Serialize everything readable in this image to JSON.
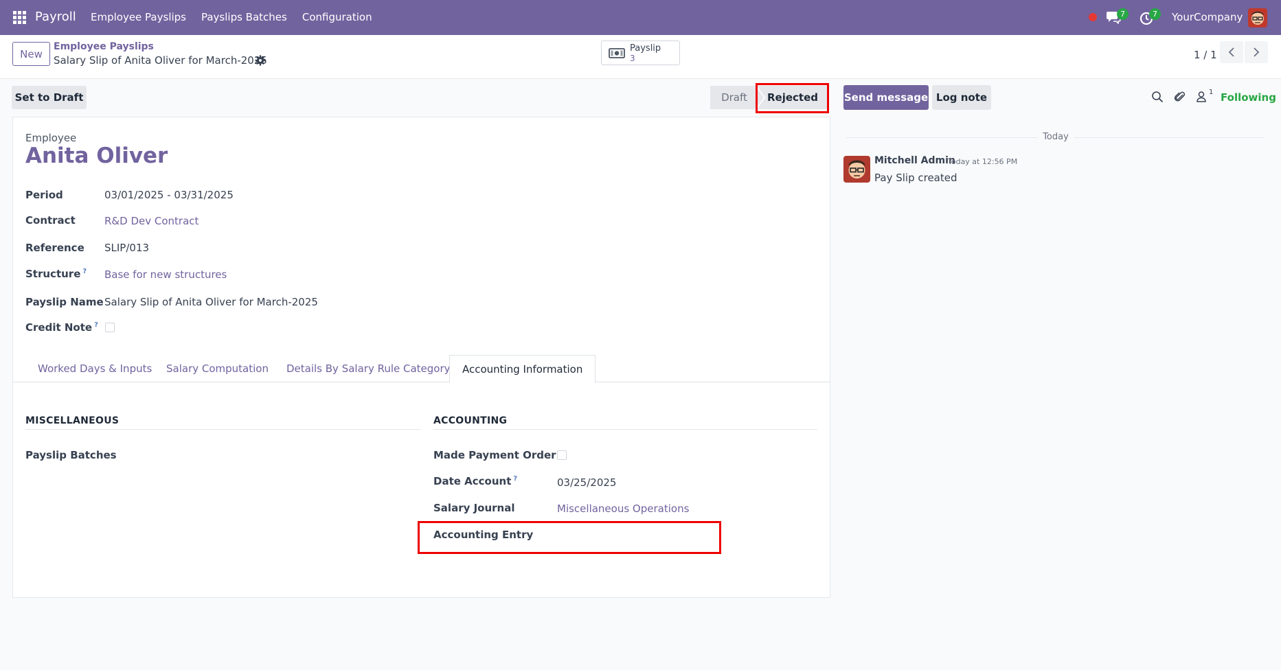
{
  "navbar": {
    "app_name": "Payroll",
    "menu": [
      "Employee Payslips",
      "Payslips Batches",
      "Configuration"
    ],
    "messages_badge": "7",
    "activities_badge": "7",
    "company": "YourCompany",
    "brand_color": "#71639e"
  },
  "control": {
    "new_label": "New",
    "breadcrumb_parent": "Employee Payslips",
    "breadcrumb_current": "Salary Slip of Anita Oliver for March-2025",
    "smart_button": {
      "label": "Payslip",
      "count": "3"
    },
    "pager": "1 / 1"
  },
  "statusbar": {
    "set_to_draft": "Set to Draft",
    "stages": [
      "Draft",
      "Rejected"
    ],
    "current": "Rejected"
  },
  "form": {
    "employee_label": "Employee",
    "employee_name": "Anita Oliver",
    "fields": {
      "period": {
        "label": "Period",
        "value": "03/01/2025 - 03/31/2025"
      },
      "contract": {
        "label": "Contract",
        "value": "R&D Dev Contract"
      },
      "reference": {
        "label": "Reference",
        "value": "SLIP/013"
      },
      "structure": {
        "label": "Structure",
        "value": "Base for new structures"
      },
      "payslip_name": {
        "label": "Payslip Name",
        "value": "Salary Slip of Anita Oliver for March-2025"
      },
      "credit_note": {
        "label": "Credit Note"
      }
    },
    "help_mark": "?",
    "tabs": [
      "Worked Days & Inputs",
      "Salary Computation",
      "Details By Salary Rule Category",
      "Accounting Information"
    ],
    "active_tab": "Accounting Information",
    "misc": {
      "title": "MISCELLANEOUS",
      "payslip_batches": "Payslip Batches"
    },
    "accounting": {
      "title": "ACCOUNTING",
      "made_payment_order": "Made Payment Order ?",
      "date_account_label": "Date Account",
      "date_account_value": "03/25/2025",
      "salary_journal_label": "Salary Journal",
      "salary_journal_value": "Miscellaneous Operations",
      "accounting_entry_label": "Accounting Entry"
    }
  },
  "chatter": {
    "send_message": "Send message",
    "log_note": "Log note",
    "follower_count": "1",
    "following": "Following",
    "today": "Today",
    "message": {
      "author": "Mitchell Admin",
      "time": "Today at 12:56 PM",
      "body": "Pay Slip created"
    }
  }
}
